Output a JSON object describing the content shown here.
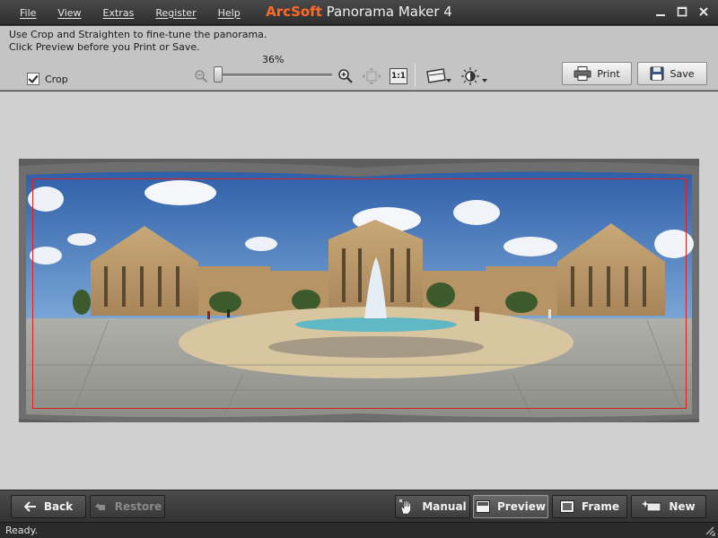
{
  "menu": {
    "items": [
      "File",
      "View",
      "Extras",
      "Register",
      "Help"
    ]
  },
  "window": {
    "brand": "ArcSoft",
    "title": " Panorama Maker 4",
    "minimize_icon": "minimize-icon",
    "maximize_icon": "maximize-icon",
    "close_icon": "close-icon"
  },
  "toolbar": {
    "instructions_line1": "Use Crop and Straighten to fine-tune the panorama.",
    "instructions_line2": "Click Preview before you Print or Save.",
    "crop_label": "Crop",
    "crop_checked": true,
    "zoom_value": "36%",
    "zoom_fraction": 0.0,
    "actual_size_label": "1:1",
    "print_label": "Print",
    "save_label": "Save"
  },
  "bottom_nav": {
    "back_label": "Back",
    "restore_label": "Restore",
    "manual_label": "Manual",
    "preview_label": "Preview",
    "frame_label": "Frame",
    "new_label": "New"
  },
  "status": {
    "text": "Ready."
  },
  "colors": {
    "brand": "#ff6a2a",
    "crop_border": "#e02020"
  }
}
